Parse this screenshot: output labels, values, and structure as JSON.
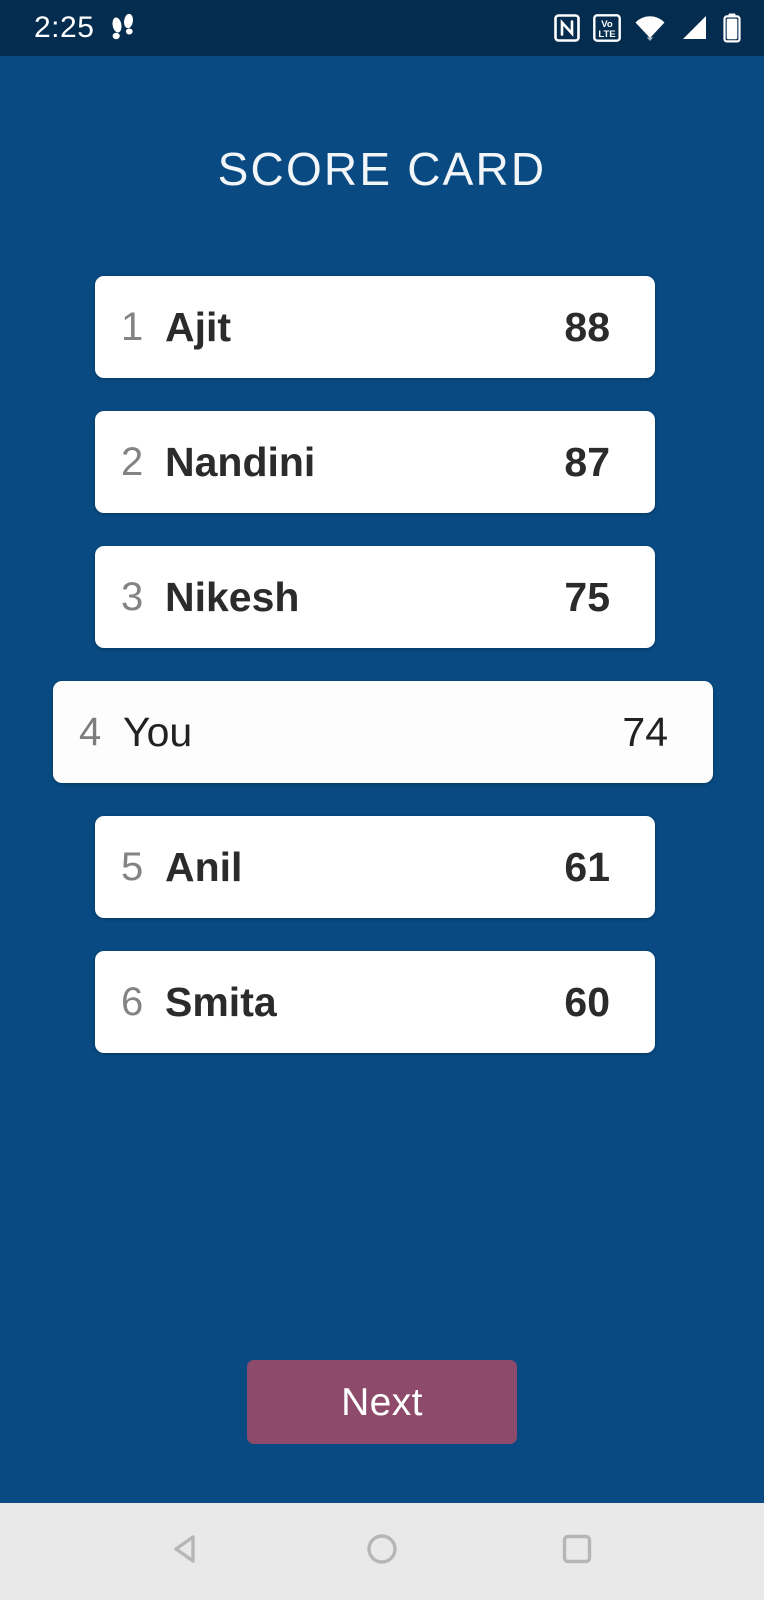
{
  "status_bar": {
    "clock": "2:25",
    "icons_left": [
      {
        "name": "footsteps-icon",
        "glyph": "footsteps"
      }
    ],
    "icons_right": [
      {
        "name": "nfc-icon",
        "label": "N"
      },
      {
        "name": "volte-icon",
        "label_top": "Vo",
        "label_bottom": "LTE"
      },
      {
        "name": "wifi-icon",
        "label": "wifi"
      },
      {
        "name": "cellular-signal-icon",
        "label": "signal"
      },
      {
        "name": "battery-icon",
        "label": "battery"
      }
    ]
  },
  "colors": {
    "background": "#084a81",
    "status_bar": "#032c4f",
    "card": "#ffffff",
    "rank_text": "#838383",
    "name_text": "#2b2b2b",
    "accent_button": "#8e4a6b",
    "nav_bar": "#e9e9e9"
  },
  "header": {
    "title": "SCORE CARD"
  },
  "scoreboard": {
    "rows": [
      {
        "rank": "1",
        "name": "Ajit",
        "score": "88",
        "highlighted": false
      },
      {
        "rank": "2",
        "name": "Nandini",
        "score": "87",
        "highlighted": false
      },
      {
        "rank": "3",
        "name": "Nikesh",
        "score": "75",
        "highlighted": false
      },
      {
        "rank": "4",
        "name": "You",
        "score": "74",
        "highlighted": true
      },
      {
        "rank": "5",
        "name": "Anil",
        "score": "61",
        "highlighted": false
      },
      {
        "rank": "6",
        "name": "Smita",
        "score": "60",
        "highlighted": false
      }
    ]
  },
  "footer": {
    "next_label": "Next"
  },
  "nav_bar": {
    "back_label": "Back",
    "home_label": "Home",
    "recents_label": "Recents"
  }
}
